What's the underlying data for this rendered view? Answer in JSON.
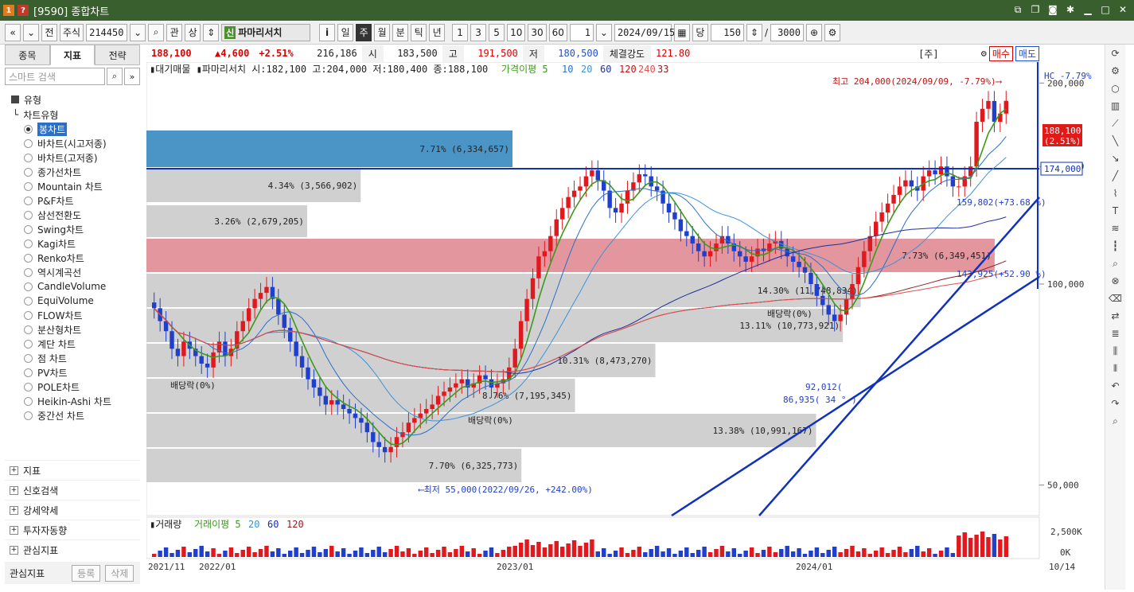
{
  "window": {
    "title": "[9590] 종합차트",
    "badge1": "1",
    "badge2": "?"
  },
  "toolbar": {
    "market": "주식",
    "code": "214450",
    "gwan": "관",
    "sang": "상",
    "stock_name": "파마리서치",
    "sin": "신",
    "info": "i",
    "periods": [
      "일",
      "주",
      "월",
      "분",
      "틱",
      "년"
    ],
    "active_period": "주",
    "intervals": [
      "1",
      "3",
      "5",
      "10",
      "30",
      "60"
    ],
    "interval_value": "1",
    "date": "2024/09/15",
    "dang": "당",
    "count": "150",
    "total": "3000",
    "jeon": "전"
  },
  "sidebar": {
    "tabs": [
      "종목",
      "지표",
      "전략"
    ],
    "active_tab": "지표",
    "search_placeholder": "스마트 검색",
    "section": "유형",
    "subsection": "차트유형",
    "chart_types": [
      "봉차트",
      "바차트(시고저종)",
      "바차트(고저종)",
      "종가선차트",
      "Mountain 차트",
      "P&F차트",
      "삼선전환도",
      "Swing차트",
      "Kagi차트",
      "Renko차트",
      "역시계곡선",
      "CandleVolume",
      "EquiVolume",
      "FLOW차트",
      "분산형차트",
      "계단 차트",
      "점 차트",
      "PV차트",
      "POLE차트",
      "Heikin-Ashi 차트",
      "중간선 차트"
    ],
    "selected": "봉차트",
    "bottom": [
      "지표",
      "신호검색",
      "강세약세",
      "투자자동향",
      "관심지표"
    ],
    "fav_label": "관심지표",
    "fav_register": "등록",
    "fav_delete": "삭제"
  },
  "quote": {
    "price": "188,100",
    "change": "▲4,600",
    "pct": "+2.51%",
    "volume": "216,186",
    "open_label": "시",
    "open": "183,500",
    "high_label": "고",
    "high": "191,500",
    "low_label": "저",
    "low": "180,500",
    "strength_label": "체결강도",
    "strength": "121.80",
    "ju": "[주]",
    "buy": "매수",
    "sell": "매도"
  },
  "legend": {
    "main": "▮대기매물 ▮파마리서치 시:182,100 고:204,000 저:180,400 종:188,100",
    "ma_label": "가격이평 5",
    "ma_others": [
      "10",
      "20",
      "60",
      "120",
      "240",
      "33"
    ],
    "vol": "▮거래량",
    "vol_ma": "거래이평 5",
    "vol_others": [
      "20",
      "60",
      "120"
    ]
  },
  "chart_data": {
    "type": "candlestick",
    "x_ticks": [
      "2021/11",
      "2022/01",
      "2023/01",
      "2024/01",
      "10/14"
    ],
    "y_ticks": [
      "200,000",
      "150,000",
      "100,000",
      "50,000"
    ],
    "ylim": [
      45000,
      215000
    ],
    "vol_ticks": [
      "2,500K",
      "0K"
    ],
    "last_price_tag": [
      "188,100",
      "(2.51%)"
    ],
    "hc": "HC  -7.79%",
    "hline": "174,000",
    "annotations": {
      "max": "최고 204,000(2024/09/09, -7.79%)⟶",
      "min": "⟵최저 55,000(2022/09/26, +242.00%)",
      "div1": "배당락(0%)",
      "div2": "배당락(0%)",
      "div3": "배당락(0%)",
      "t1": "159,802(+73.68 %)",
      "t2": "143,925(+52.90 %)",
      "t3": "92,012(",
      "t4": "86,935( 34 ° )"
    },
    "profile": [
      {
        "label": "7.71% (6,334,657)",
        "top": 0.0,
        "len": 0.41,
        "color": "#4a95c6",
        "text": "#222"
      },
      {
        "label": "4.34% (3,566,902)",
        "top": 1,
        "len": 0.24,
        "color": "#d0d0d0"
      },
      {
        "label": "3.26% (2,679,205)",
        "top": 2,
        "len": 0.18,
        "color": "#d0d0d0"
      },
      {
        "label": "7.73% (6,349,451)",
        "top": 3,
        "len": 0.95,
        "color": "#e3969e"
      },
      {
        "label": "14.30% (11,748,834)",
        "top": 4,
        "len": 0.8,
        "color": "#d0d0d0"
      },
      {
        "label": "13.11% (10,773,921)",
        "top": 5,
        "len": 0.78,
        "color": "#d0d0d0"
      },
      {
        "label": "10.31% (8,473,270)",
        "top": 6,
        "len": 0.57,
        "color": "#d0d0d0"
      },
      {
        "label": "8.76% (7,195,345)",
        "top": 7,
        "len": 0.48,
        "color": "#d0d0d0"
      },
      {
        "label": "13.38% (10,991,167)",
        "top": 8,
        "len": 0.75,
        "color": "#d0d0d0"
      },
      {
        "label": "7.70% (6,325,773)",
        "top": 9,
        "len": 0.42,
        "color": "#d0d0d0"
      }
    ],
    "closes": [
      92000,
      88000,
      85000,
      80000,
      78000,
      82000,
      80000,
      78000,
      76000,
      75000,
      79000,
      82000,
      78000,
      80000,
      85000,
      88000,
      92000,
      95000,
      97000,
      99000,
      95000,
      90000,
      86000,
      82000,
      78000,
      75000,
      72000,
      70000,
      68000,
      66000,
      67000,
      66000,
      65000,
      64000,
      63000,
      62000,
      60000,
      58000,
      57000,
      56000,
      57000,
      59000,
      60000,
      62000,
      63000,
      64000,
      65000,
      66000,
      68000,
      69000,
      70000,
      71000,
      72000,
      70000,
      71000,
      73000,
      72000,
      70000,
      71000,
      72000,
      75000,
      80000,
      88000,
      95000,
      102000,
      110000,
      112000,
      118000,
      125000,
      130000,
      135000,
      138000,
      140000,
      145000,
      148000,
      143000,
      138000,
      130000,
      128000,
      132000,
      138000,
      142000,
      146000,
      145000,
      140000,
      138000,
      132000,
      128000,
      125000,
      120000,
      118000,
      115000,
      112000,
      110000,
      112000,
      115000,
      118000,
      115000,
      112000,
      110000,
      108000,
      110000,
      113000,
      112000,
      115000,
      116000,
      113000,
      110000,
      108000,
      106000,
      104000,
      100000,
      96000,
      93000,
      90000,
      88000,
      90000,
      95000,
      100000,
      106000,
      112000,
      118000,
      124000,
      128000,
      132000,
      136000,
      140000,
      143000,
      140000,
      138000,
      145000,
      148000,
      146000,
      150000,
      145000,
      140000,
      140000,
      145000,
      150000,
      175000,
      183000,
      188000,
      175000,
      180000,
      188100
    ]
  }
}
